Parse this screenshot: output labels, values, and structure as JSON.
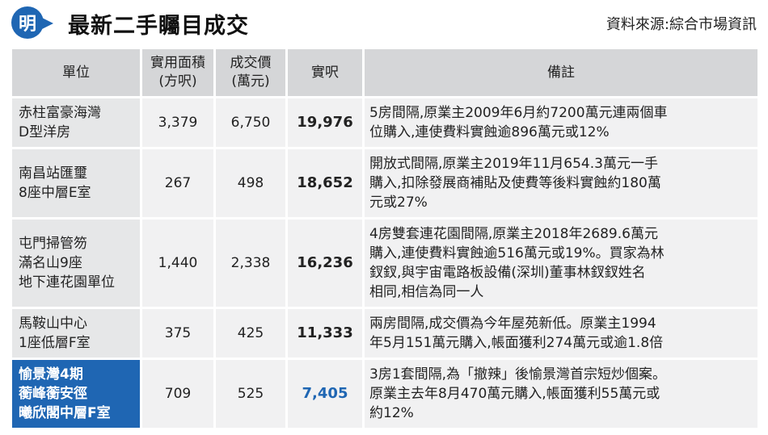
{
  "header": {
    "logo_text": "明",
    "title": "最新二手矚目成交",
    "source": "資料來源:綜合市場資訊"
  },
  "table": {
    "columns": [
      {
        "lines": [
          "單位"
        ]
      },
      {
        "lines": [
          "實用面積",
          "(方呎)"
        ]
      },
      {
        "lines": [
          "成交價",
          "(萬元)"
        ]
      },
      {
        "lines": [
          "實呎"
        ]
      },
      {
        "lines": [
          "備註"
        ]
      }
    ],
    "rows": [
      {
        "unit": [
          "赤柱富豪海灣",
          "D型洋房"
        ],
        "area": "3,379",
        "price": "6,750",
        "ppsf": "19,976",
        "remark": [
          "5房間隔,原業主2009年6月約7200萬元連兩個車",
          "位購入,連使費料實蝕逾896萬元或12%"
        ]
      },
      {
        "unit": [
          "南昌站匯璽",
          "8座中層E室"
        ],
        "area": "267",
        "price": "498",
        "ppsf": "18,652",
        "remark": [
          "開放式間隔,原業主2019年11月654.3萬元一手",
          "購入,扣除發展商補貼及使費等後料實蝕約180萬",
          "元或27%"
        ]
      },
      {
        "unit": [
          "屯門掃管笏",
          "滿名山9座",
          "地下連花園單位"
        ],
        "area": "1,440",
        "price": "2,338",
        "ppsf": "16,236",
        "remark": [
          "4房雙套連花園間隔,原業主2018年2689.6萬元",
          "購入,連使費料實蝕逾516萬元或19%。買家為林",
          "釵釵,與宇宙電路板設備(深圳)董事林釵釵姓名",
          "相同,相信為同一人"
        ]
      },
      {
        "unit": [
          "馬鞍山中心",
          "1座低層F室"
        ],
        "area": "375",
        "price": "425",
        "ppsf": "11,333",
        "remark": [
          "兩房間隔,成交價為今年屋苑新低。原業主1994",
          "年5月151萬元購入,帳面獲利274萬元或逾1.8倍"
        ]
      },
      {
        "unit": [
          "愉景灣4期",
          "蘅峰蘅安徑",
          "曦欣閣中層F室"
        ],
        "area": "709",
        "price": "525",
        "ppsf": "7,405",
        "remark": [
          "3房1套間隔,為「撤辣」後愉景灣首宗短炒個案。",
          "原業主去年8月470萬元購入,帳面獲利55萬元或",
          "約12%"
        ],
        "highlight": true
      }
    ]
  },
  "colors": {
    "brand_blue": "#1f66b3",
    "header_gray": "#d5d6d8",
    "cell_gray": "#f1f1f2"
  }
}
